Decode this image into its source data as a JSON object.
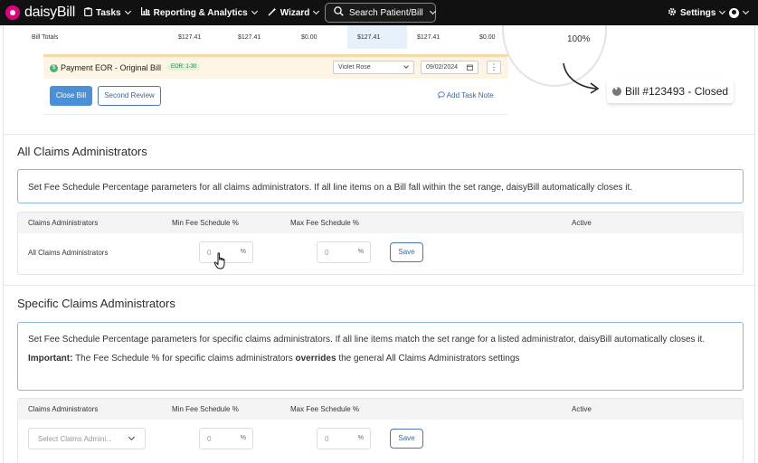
{
  "topnav": {
    "brand": "daisyBill",
    "tasks_label": "Tasks",
    "reporting_label": "Reporting & Analytics",
    "wizard_label": "Wizard",
    "search_label": "Search Patient/Bill",
    "settings_label": "Settings"
  },
  "snapshot": {
    "bill_totals": {
      "label": "Bill Totals",
      "values": [
        "$127.41",
        "$127.41",
        "$0.00",
        "$127.41",
        "$127.41",
        "$0.00"
      ]
    },
    "eor": {
      "title": "Payment EOR - Original Bill",
      "badge": "EOR: 1-30",
      "reviewer": "Violet Rose",
      "date": "09/02/2024",
      "dollar_icon": "$"
    },
    "close_bill_label": "Close Bill",
    "second_review_label": "Second Review",
    "task_note_label": "Add Task Note"
  },
  "callout": {
    "percent": "100%",
    "bill_status": "Bill #123493 - Closed"
  },
  "all_section": {
    "title": "All Claims Administrators",
    "info": "Set Fee Schedule Percentage parameters for all claims administrators. If all line items on a Bill fall within the set range, daisyBill automatically closes it.",
    "headers": {
      "admin": "Claims Administrators",
      "min": "Min Fee Schedule %",
      "max": "Max Fee Schedule %",
      "active": "Active"
    },
    "row": {
      "admin": "All Claims Administrators",
      "min_placeholder": "0",
      "max_placeholder": "0",
      "pct_symbol": "%",
      "save_label": "Save"
    }
  },
  "specific_section": {
    "title": "Specific Claims Administrators",
    "info": "Set Fee Schedule Percentage parameters for specific claims administrators. If all line items match the set range for a listed administrator, daisyBill automatically closes it.",
    "important_label": "Important:",
    "important_text_1": "The Fee Schedule % for specific claims administrators",
    "important_bold": "overrides",
    "important_text_2": "the general All Claims Administrators settings",
    "headers": {
      "admin": "Claims Administrators",
      "min": "Min Fee Schedule %",
      "max": "Max Fee Schedule %",
      "active": "Active"
    },
    "row": {
      "select_placeholder": "Select Claims Admini...",
      "min_placeholder": "0",
      "max_placeholder": "0",
      "pct_symbol": "%",
      "save_label": "Save"
    }
  },
  "colors": {
    "nav_bg": "#111111",
    "brand_pink": "#e4007c",
    "accent_blue": "#4a90d9",
    "info_border": "#8ab8e0"
  }
}
